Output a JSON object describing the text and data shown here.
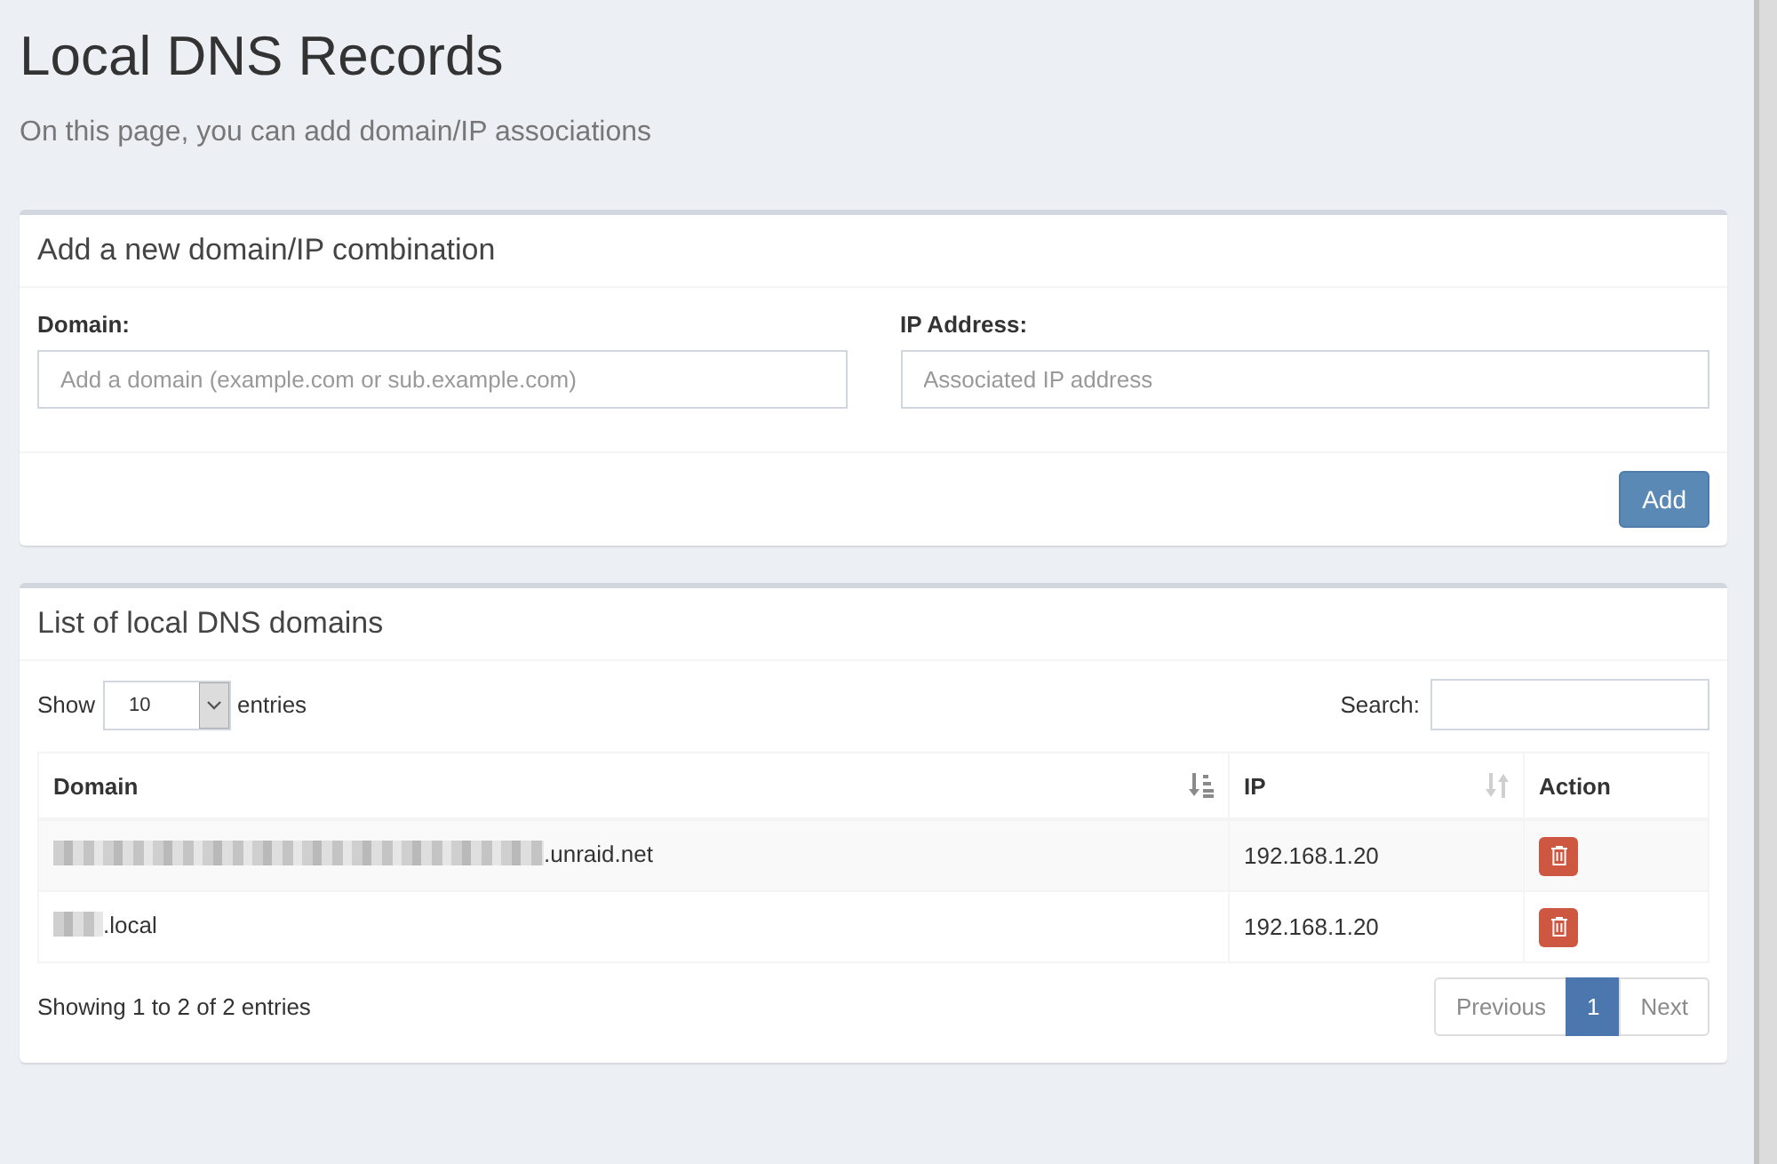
{
  "page": {
    "title": "Local DNS Records",
    "subtitle": "On this page, you can add domain/IP associations"
  },
  "add_box": {
    "title": "Add a new domain/IP combination",
    "fields": [
      {
        "label": "Domain:",
        "placeholder": "Add a domain (example.com or sub.example.com)"
      },
      {
        "label": "IP Address:",
        "placeholder": "Associated IP address"
      }
    ],
    "button": "Add"
  },
  "list_box": {
    "title": "List of local DNS domains",
    "length": {
      "prefix": "Show",
      "value": "10",
      "suffix": "entries"
    },
    "search": {
      "label": "Search:"
    },
    "table": {
      "columns": [
        {
          "label": "Domain",
          "kind": "sorted"
        },
        {
          "label": "IP",
          "kind": "sortable"
        },
        {
          "label": "Action",
          "kind": "plain"
        }
      ],
      "rows": [
        {
          "domain": ".unraid.net",
          "redacted": true,
          "ip": "192.168.1.20"
        },
        {
          "domain": ".local",
          "redacted": true,
          "ip": "192.168.1.20"
        }
      ]
    },
    "info": "Showing 1 to 2 of 2 entries",
    "pagination": [
      {
        "label": "Previous",
        "selected": false,
        "disabled": true
      },
      {
        "label": "1",
        "selected": true,
        "disabled": false
      },
      {
        "label": "Next",
        "selected": false,
        "disabled": true
      }
    ]
  }
}
